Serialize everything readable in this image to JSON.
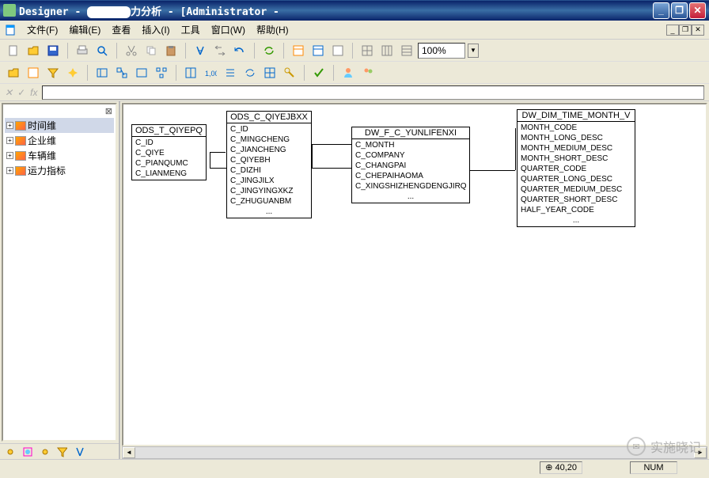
{
  "title": {
    "prefix": "Designer - ",
    "suffix": "力分析 - [Administrator -"
  },
  "menu": {
    "file": "文件(F)",
    "edit": "编辑(E)",
    "view": "查看",
    "insert": "插入(I)",
    "tool": "工具",
    "window": "窗口(W)",
    "help": "帮助(H)"
  },
  "zoom": "100%",
  "formula": {
    "x": "✕",
    "check": "✓",
    "fx": "fx"
  },
  "tree": {
    "items": [
      {
        "label": "时间维"
      },
      {
        "label": "企业维"
      },
      {
        "label": "车辆维"
      },
      {
        "label": "运力指标"
      }
    ]
  },
  "entities": {
    "e1": {
      "title": "ODS_T_QIYEPQ",
      "cols": [
        "C_ID",
        "C_QIYE",
        "C_PIANQUMC",
        "C_LIANMENG"
      ]
    },
    "e2": {
      "title": "ODS_C_QIYEJBXX",
      "cols": [
        "C_ID",
        "C_MINGCHENG",
        "C_JIANCHENG",
        "C_QIYEBH",
        "C_DIZHI",
        "C_JINGJILX",
        "C_JINGYINGXKZ",
        "C_ZHUGUANBM"
      ]
    },
    "e3": {
      "title": "DW_F_C_YUNLIFENXI",
      "cols": [
        "C_MONTH",
        "C_COMPANY",
        "C_CHANGPAI",
        "C_CHEPAIHAOMA",
        "C_XINGSHIZHENGDENGJIRQ"
      ]
    },
    "e4": {
      "title": "DW_DIM_TIME_MONTH_V",
      "cols": [
        "MONTH_CODE",
        "MONTH_LONG_DESC",
        "MONTH_MEDIUM_DESC",
        "MONTH_SHORT_DESC",
        "QUARTER_CODE",
        "QUARTER_LONG_DESC",
        "QUARTER_MEDIUM_DESC",
        "QUARTER_SHORT_DESC",
        "HALF_YEAR_CODE"
      ]
    }
  },
  "dots": "...",
  "status": {
    "coords": "40,20",
    "num": "NUM"
  },
  "watermark": "实施晓记"
}
